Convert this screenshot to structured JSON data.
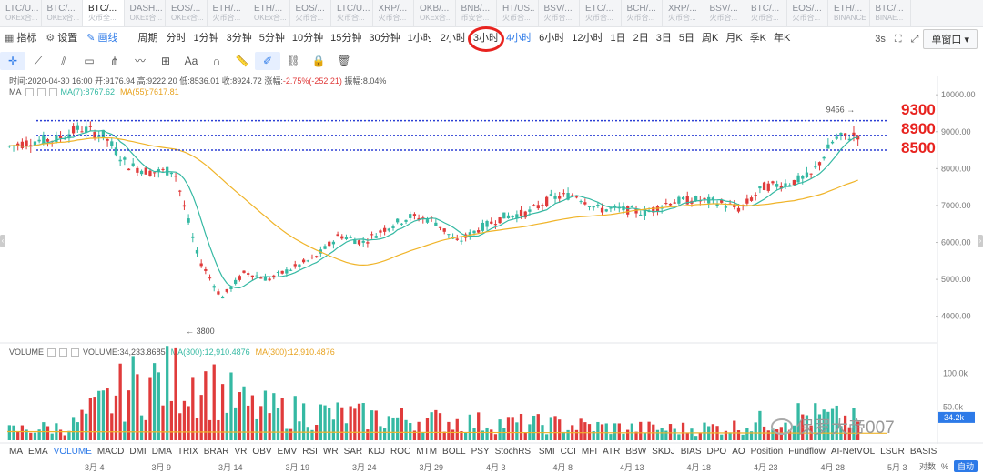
{
  "tabs": [
    {
      "symbol": "LTC/U...",
      "exchange": "OKEx合..."
    },
    {
      "symbol": "BTC/...",
      "exchange": "OKEx合..."
    },
    {
      "symbol": "BTC/...",
      "exchange": "火币全..."
    },
    {
      "symbol": "DASH...",
      "exchange": "OKEx合..."
    },
    {
      "symbol": "EOS/...",
      "exchange": "OKEx合..."
    },
    {
      "symbol": "ETH/...",
      "exchange": "火币合..."
    },
    {
      "symbol": "ETH/...",
      "exchange": "OKEx合..."
    },
    {
      "symbol": "EOS/...",
      "exchange": "火币合..."
    },
    {
      "symbol": "LTC/U...",
      "exchange": "火币合..."
    },
    {
      "symbol": "XRP/...",
      "exchange": "火币合..."
    },
    {
      "symbol": "OKB/...",
      "exchange": "OKEx合..."
    },
    {
      "symbol": "BNB/...",
      "exchange": "币安合..."
    },
    {
      "symbol": "HT/US...",
      "exchange": "火币合..."
    },
    {
      "symbol": "BSV/...",
      "exchange": "火币合..."
    },
    {
      "symbol": "ETC/...",
      "exchange": "火币合..."
    },
    {
      "symbol": "BCH/...",
      "exchange": "火币合..."
    },
    {
      "symbol": "XRP/...",
      "exchange": "火币合..."
    },
    {
      "symbol": "BSV/...",
      "exchange": "火币合..."
    },
    {
      "symbol": "BTC/...",
      "exchange": "火币合..."
    },
    {
      "symbol": "EOS/...",
      "exchange": "火币合..."
    },
    {
      "symbol": "ETH/...",
      "exchange": "BINANCE..."
    },
    {
      "symbol": "BTC/...",
      "exchange": "BINAE..."
    }
  ],
  "toolbar": {
    "indicator": "指标",
    "settings": "设置",
    "draw": "画线",
    "period": "周期",
    "intervals": [
      "分时",
      "1分钟",
      "3分钟",
      "5分钟",
      "10分钟",
      "15分钟",
      "30分钟",
      "1小时",
      "2小时",
      "3小时",
      "4小时",
      "6小时",
      "12小时",
      "1日",
      "2日",
      "3日",
      "5日",
      "周K",
      "月K",
      "季K",
      "年K"
    ],
    "active_interval": "4小时",
    "refresh": "3s",
    "window": "单窗口"
  },
  "info": {
    "time": "时间:2020-04-30 16:00",
    "open": "开:9176.94",
    "high": "高:9222.20",
    "low": "低:8536.01",
    "close": "收:8924.72",
    "change_label": "涨幅:",
    "change": "-2.75%(-252.21)",
    "amplitude": "振幅:8.04%"
  },
  "ma": {
    "label": "MA",
    "ma7": "MA(7):8767.62",
    "ma55": "MA(55):7617.81"
  },
  "volume": {
    "label": "VOLUME",
    "value": "VOLUME:34,233.8685",
    "ma300a": "MA(300):12,910.4876",
    "ma300b": "MA(300):12,910.4876"
  },
  "price_axis": [
    "10000.00",
    "9000.00",
    "8000.00",
    "7000.00",
    "6000.00",
    "5000.00",
    "4000.00"
  ],
  "volume_axis": [
    "100.0k",
    "50.0k"
  ],
  "volume_current": "34.2k",
  "markers": {
    "high": "9456",
    "low": "3800"
  },
  "annotations": [
    "9300",
    "8900",
    "8500"
  ],
  "indicators": [
    "MA",
    "EMA",
    "VOLUME",
    "MACD",
    "DMI",
    "DMA",
    "TRIX",
    "BRAR",
    "VR",
    "OBV",
    "EMV",
    "RSI",
    "WR",
    "SAR",
    "KDJ",
    "ROC",
    "MTM",
    "BOLL",
    "PSY",
    "StochRSI",
    "SMI",
    "CCI",
    "MFI",
    "ATR",
    "BBW",
    "SKDJ",
    "BIAS",
    "DPO",
    "AO",
    "Position",
    "Fundflow",
    "AI-NetVOL",
    "LSUR",
    "BASIS"
  ],
  "active_indicator": "VOLUME",
  "dates": [
    "3月 4",
    "3月 9",
    "3月 14",
    "3月 19",
    "3月 24",
    "3月 29",
    "4月 3",
    "4月 8",
    "4月 13",
    "4月 18",
    "4月 23",
    "4月 28",
    "5月 3"
  ],
  "date_controls": {
    "log": "对数",
    "percent": "%",
    "auto": "自动"
  },
  "watermark": "保罗大帝007",
  "colors": {
    "up": "#35b9a3",
    "down": "#e03b3b",
    "ma7": "#35b9a3",
    "ma55": "#f0b429",
    "level": "#2b3fd4",
    "accent": "#2d7ae8",
    "annotation": "#e8231f"
  },
  "chart_data": {
    "type": "candlestick",
    "price_range": [
      3500,
      10300
    ],
    "close_path": [
      [
        "3月 1",
        8600
      ],
      [
        "3月 2",
        8750
      ],
      [
        "3月 4",
        8800
      ],
      [
        "3月 6",
        9100
      ],
      [
        "3月 8",
        8900
      ],
      [
        "3月 9",
        8100
      ],
      [
        "3月 10",
        7900
      ],
      [
        "3月 11",
        7950
      ],
      [
        "3月 12",
        5600
      ],
      [
        "3月 13",
        4500
      ],
      [
        "3月 14",
        5200
      ],
      [
        "3月 16",
        5000
      ],
      [
        "3月 17",
        5300
      ],
      [
        "3月 19",
        5600
      ],
      [
        "3月 20",
        6200
      ],
      [
        "3月 22",
        6000
      ],
      [
        "3月 23",
        6400
      ],
      [
        "3月 25",
        6700
      ],
      [
        "3月 27",
        6600
      ],
      [
        "3月 29",
        6000
      ],
      [
        "3月 31",
        6400
      ],
      [
        "4月 2",
        6700
      ],
      [
        "4月 4",
        6800
      ],
      [
        "4月 6",
        7200
      ],
      [
        "4月 8",
        7300
      ],
      [
        "4月 10",
        6900
      ],
      [
        "4月 12",
        6900
      ],
      [
        "4月 14",
        6800
      ],
      [
        "4月 16",
        7100
      ],
      [
        "4月 18",
        7150
      ],
      [
        "4月 20",
        7100
      ],
      [
        "4月 22",
        6900
      ],
      [
        "4月 24",
        7500
      ],
      [
        "4月 26",
        7600
      ],
      [
        "4月 28",
        7800
      ],
      [
        "4月 29",
        8800
      ],
      [
        "4月 30",
        8924
      ]
    ],
    "levels": [
      9300,
      8900,
      8500
    ],
    "volume_range": [
      0,
      120000
    ],
    "volume_profile": [
      [
        "3月 1",
        18000
      ],
      [
        "3月 8",
        24000
      ],
      [
        "3月 12",
        95000
      ],
      [
        "3月 13",
        110000
      ],
      [
        "3月 16",
        55000
      ],
      [
        "3月 20",
        48000
      ],
      [
        "3月 24",
        40000
      ],
      [
        "3月 29",
        35000
      ],
      [
        "4月 3",
        30000
      ],
      [
        "4月 8",
        28000
      ],
      [
        "4月 13",
        22000
      ],
      [
        "4月 18",
        20000
      ],
      [
        "4月 23",
        24000
      ],
      [
        "4月 29",
        45000
      ],
      [
        "4月 30",
        34234
      ]
    ]
  }
}
